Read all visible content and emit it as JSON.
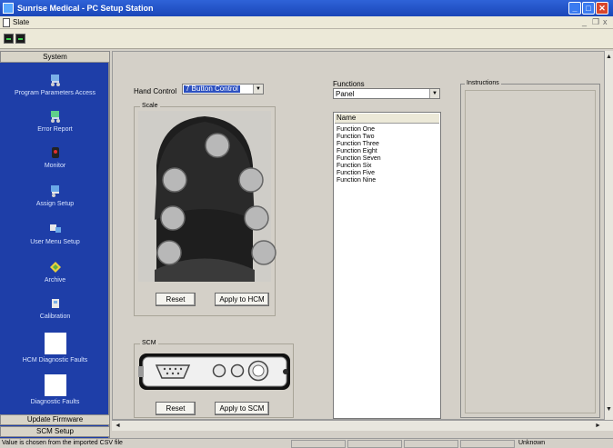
{
  "window": {
    "title": "Sunrise Medical - PC Setup Station",
    "minimize_glyph": "_",
    "maximize_glyph": "□",
    "close_glyph": "✕"
  },
  "menu": {
    "file": "Slate",
    "mdi_minimize": "_",
    "mdi_restore": "❐",
    "mdi_close": "x"
  },
  "toolbar": {
    "buttons": [
      "toolbar-button-1",
      "toolbar-button-2"
    ]
  },
  "sidebar": {
    "header": "System",
    "items": [
      {
        "label": "Program Parameters Access",
        "icon": "chair-icon"
      },
      {
        "label": "Error Report",
        "icon": "chair-error-icon"
      },
      {
        "label": "Monitor",
        "icon": "monitor-icon"
      },
      {
        "label": "Assign Setup",
        "icon": "assign-icon"
      },
      {
        "label": "User Menu Setup",
        "icon": "menu-setup-icon"
      },
      {
        "label": "Archive",
        "icon": "archive-icon"
      },
      {
        "label": "Calibration",
        "icon": "calibration-icon"
      },
      {
        "label": "HCM Diagnostic Faults",
        "icon": "blank-white-icon"
      },
      {
        "label": "Diagnostic Faults",
        "icon": "blank-white-icon"
      }
    ],
    "footer": [
      "Update Firmware",
      "SCM Setup"
    ]
  },
  "main": {
    "hand_control_label": "Hand Control",
    "hand_control_value": "7 Button Control",
    "buttons_group_title": "Scale",
    "hand_reset": "Reset",
    "hand_apply": "Apply to HCM",
    "scm_group_title": "SCM",
    "scm_reset": "Reset",
    "scm_apply": "Apply to SCM",
    "functions_label": "Functions",
    "functions_value": "Panel",
    "list_header": "Name",
    "functions": [
      "Function One",
      "Function Two",
      "Function Three",
      "Function Eight",
      "Function Seven",
      "Function Six",
      "Function Five",
      "Function Nine"
    ],
    "instructions_title": "Instructions"
  },
  "status": {
    "message": "Value is chosen from the imported CSV file",
    "right": "Unknown",
    "scroll_up": "▲",
    "scroll_down": "▼",
    "scroll_left": "◄",
    "scroll_right": "►"
  },
  "colors": {
    "sidebar_bg": "#1e3ea8",
    "title_bg": "#2f63d8",
    "selected_bg": "#2c50c0"
  }
}
